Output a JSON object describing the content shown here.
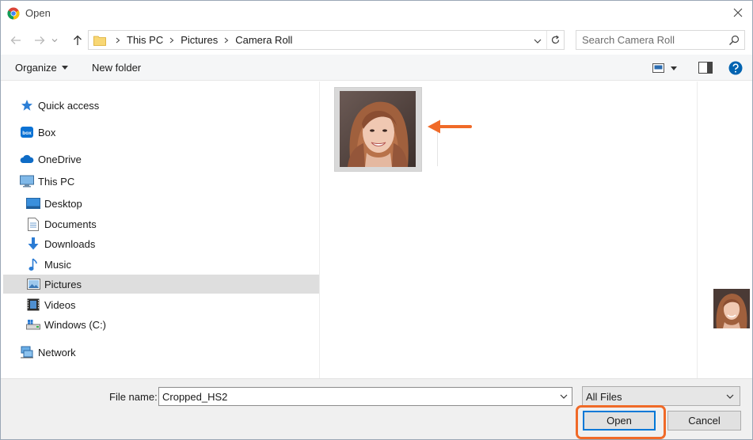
{
  "window": {
    "title": "Open",
    "accent_color": "#0078d7",
    "annotation_color": "#f06a28"
  },
  "address": {
    "crumbs": [
      "This PC",
      "Pictures",
      "Camera Roll"
    ],
    "search_placeholder": "Search Camera Roll"
  },
  "toolbar": {
    "organize_label": "Organize",
    "new_folder_label": "New folder"
  },
  "nav": {
    "items": [
      {
        "label": "Quick access",
        "icon": "star-icon"
      },
      {
        "label": "Box",
        "icon": "box-icon"
      },
      {
        "label": "OneDrive",
        "icon": "cloud-icon"
      },
      {
        "label": "This PC",
        "icon": "computer-icon"
      },
      {
        "label": "Desktop",
        "icon": "desktop-icon"
      },
      {
        "label": "Documents",
        "icon": "document-icon"
      },
      {
        "label": "Downloads",
        "icon": "download-arrow-icon"
      },
      {
        "label": "Music",
        "icon": "music-note-icon"
      },
      {
        "label": "Pictures",
        "icon": "pictures-icon",
        "selected": true
      },
      {
        "label": "Videos",
        "icon": "film-icon"
      },
      {
        "label": "Windows (C:)",
        "icon": "drive-icon"
      },
      {
        "label": "Network",
        "icon": "network-icon"
      }
    ]
  },
  "footer": {
    "file_name_label": "File name:",
    "file_name_value": "Cropped_HS2",
    "file_type_value": "All Files",
    "open_label": "Open",
    "cancel_label": "Cancel"
  }
}
